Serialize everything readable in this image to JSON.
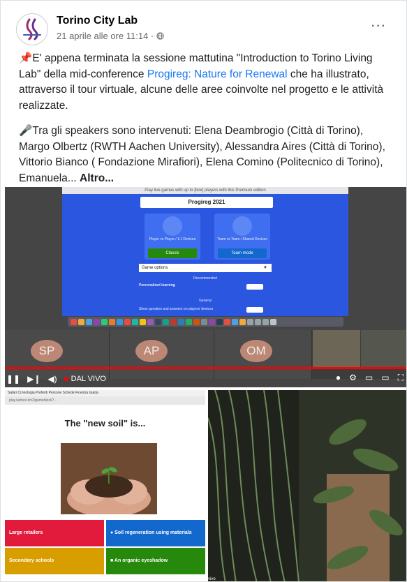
{
  "post": {
    "page_name": "Torino City Lab",
    "timestamp": "21 aprile alle ore 11:14 ·",
    "audience_icon": "globe-icon",
    "more_options": "···",
    "paragraph1_emoji": "📌",
    "paragraph1_a": "E' appena terminata la sessione mattutina \"Introduction to Torino Living Lab\" della mid-conference ",
    "paragraph1_link": "Progireg: Nature for Renewal",
    "paragraph1_b": " che ha illustrato, attraverso il tour virtuale, alcune delle aree coinvolte nel progetto e le attività realizzate.",
    "paragraph2_emoji": "🎤",
    "paragraph2": "Tra gli speakers sono intervenuti: Elena Deambrogio (Città di Torino), Margo Olbertz (RWTH Aachen University), Alessandra Aires (Città di Torino), Vittorio Bianco ( Fondazione Mirafiori), Elena Comino (Politecnico di Torino), Emanuela... ",
    "see_more": "Altro..."
  },
  "video1": {
    "share_topbar": "Play live games with up to [box] players with this Premium edition",
    "game_title": "Progireg 2021",
    "mode1_text": "Player vs Player / 1:1 Devices",
    "mode1_button": "Classic",
    "mode2_text": "Team vs Team / Shared Devices",
    "mode2_button": "Team mode",
    "game_options": "Game options",
    "recommended": "Recommended",
    "personalized": "Personalized learning",
    "general": "General",
    "show_question": "Show question and answers on players' devices",
    "participants": [
      "SP",
      "AP",
      "OM"
    ],
    "live_label": "DAL VIVO",
    "progress": 1.0,
    "colors": {
      "share_bg": "#2b56e0",
      "classic_btn": "#26890c",
      "team_btn": "#1368ce",
      "initials_bg": "#c98f7a",
      "progress": "#ff0000"
    }
  },
  "video2": {
    "menubar": "Safari  Cronologia  Preferiti  Persone  Schede  Finestra  Guida",
    "url": "play.kahoot.it/v2/gameblock?...",
    "slide_title": "The \"new soil\" is...",
    "answers": [
      {
        "label": "Large retailers",
        "color": "#e21b3c"
      },
      {
        "label": "Soil regeneration using materials",
        "color": "#1368ce"
      },
      {
        "label": "Secondary schools",
        "color": "#d89e00"
      },
      {
        "label": "An organic eyeshadow",
        "color": "#26890c"
      }
    ]
  },
  "video3": {
    "live_label": "vivo"
  }
}
